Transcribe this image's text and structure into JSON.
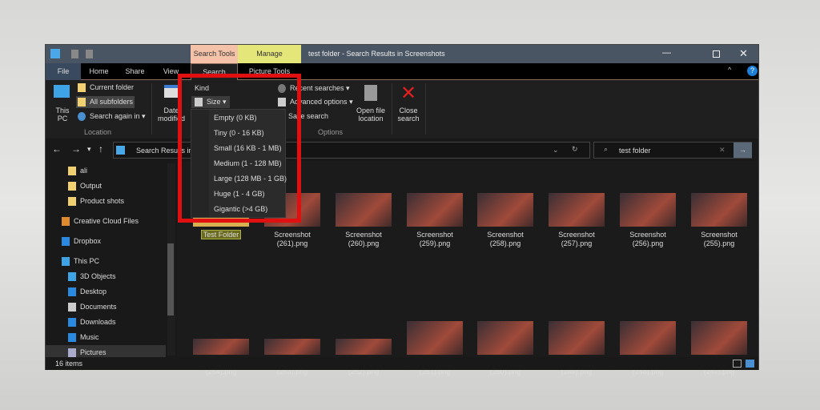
{
  "window": {
    "title": "test folder - Search Results in Screenshots",
    "context_tabs": [
      "Search Tools",
      "Manage"
    ]
  },
  "tabs": [
    "File",
    "Home",
    "Share",
    "View",
    "Search",
    "Picture Tools"
  ],
  "ribbon": {
    "this_pc": "This PC",
    "current_folder": "Current folder",
    "all_subfolders": "All subfolders",
    "search_again": "Search again in",
    "location_group": "Location",
    "date_modified": "Date modified",
    "kind": "Kind",
    "size": "Size",
    "recent_searches": "Recent searches",
    "advanced_options": "Advanced options",
    "save_search": "Save search",
    "options_group": "Options",
    "open_file_location": "Open file location",
    "close_search": "Close search"
  },
  "size_menu": [
    "Empty (0 KB)",
    "Tiny (0 - 16 KB)",
    "Small (16 KB - 1 MB)",
    "Medium (1 - 128 MB)",
    "Large (128 MB - 1 GB)",
    "Huge (1 - 4 GB)",
    "Gigantic (>4 GB)"
  ],
  "address": {
    "path": "Search Results in Screenshots",
    "search_value": "test folder"
  },
  "sidebar": [
    "ali",
    "Output",
    "Product shots",
    "Creative Cloud Files",
    "Dropbox",
    "This PC",
    "3D Objects",
    "Desktop",
    "Documents",
    "Downloads",
    "Music",
    "Pictures"
  ],
  "files_row1": [
    {
      "name": "Test Folder",
      "ext": ""
    },
    {
      "name": "Screenshot",
      "ext": "(261).png"
    },
    {
      "name": "Screenshot",
      "ext": "(260).png"
    },
    {
      "name": "Screenshot",
      "ext": "(259).png"
    },
    {
      "name": "Screenshot",
      "ext": "(258).png"
    },
    {
      "name": "Screenshot",
      "ext": "(257).png"
    },
    {
      "name": "Screenshot",
      "ext": "(256).png"
    },
    {
      "name": "Screenshot",
      "ext": "(255).png"
    }
  ],
  "files_row2": [
    {
      "name": "Screenshot",
      "ext": "(254).png"
    },
    {
      "name": "Screenshot",
      "ext": "(253).png"
    },
    {
      "name": "Screenshot",
      "ext": "(252).png"
    },
    {
      "name": "Screenshot",
      "ext": "(251).png"
    },
    {
      "name": "Screenshot",
      "ext": "(250).png"
    },
    {
      "name": "Screenshot",
      "ext": "(249).png"
    },
    {
      "name": "Screenshot",
      "ext": "(248).png"
    },
    {
      "name": "Screenshot",
      "ext": "(247).png"
    }
  ],
  "status": {
    "count": "16 items"
  }
}
